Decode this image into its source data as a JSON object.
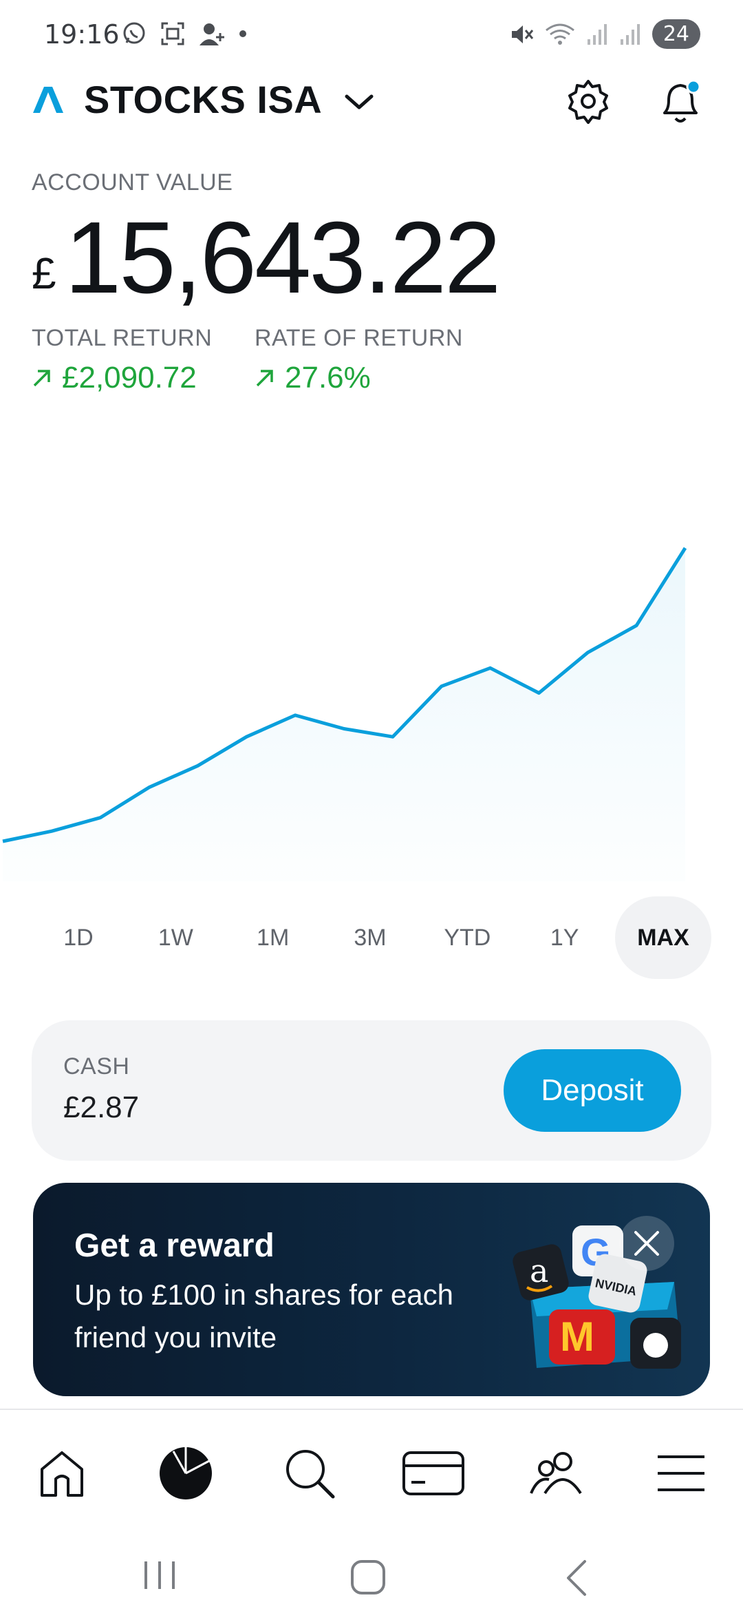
{
  "status_bar": {
    "time": "19:16",
    "battery": "24",
    "icons_left": [
      "whatsapp-icon",
      "screenshot-icon",
      "person-add-icon",
      "dot-icon"
    ],
    "icons_right": [
      "mute-icon",
      "wifi-icon",
      "signal-icon",
      "signal-icon"
    ]
  },
  "header": {
    "account_name": "STOCKS ISA",
    "brand_color": "#0a9fdc"
  },
  "summary": {
    "account_value_label": "ACCOUNT VALUE",
    "currency_symbol": "£",
    "account_value": "15,643.22",
    "total_return_label": "TOTAL RETURN",
    "total_return_value": "£2,090.72",
    "rate_of_return_label": "RATE OF RETURN",
    "rate_of_return_value": "27.6%",
    "positive_color": "#1fa53c"
  },
  "chart_data": {
    "type": "area",
    "line_color": "#0a9fdc",
    "values": [
      0.0,
      0.15,
      0.35,
      0.8,
      1.12,
      1.55,
      1.87,
      1.67,
      1.55,
      2.3,
      2.57,
      2.2,
      2.8,
      3.2,
      4.35
    ]
  },
  "ranges": {
    "items": [
      "1D",
      "1W",
      "1M",
      "3M",
      "YTD",
      "1Y",
      "MAX"
    ],
    "selected": "MAX"
  },
  "cash": {
    "label": "CASH",
    "value": "£2.87",
    "deposit_label": "Deposit"
  },
  "promo": {
    "title": "Get a reward",
    "description": "Up to £100 in shares for each friend you invite"
  },
  "bottom_nav": {
    "items": [
      "home-icon",
      "portfolio-pie-icon",
      "search-icon",
      "card-icon",
      "people-icon",
      "menu-icon"
    ]
  }
}
